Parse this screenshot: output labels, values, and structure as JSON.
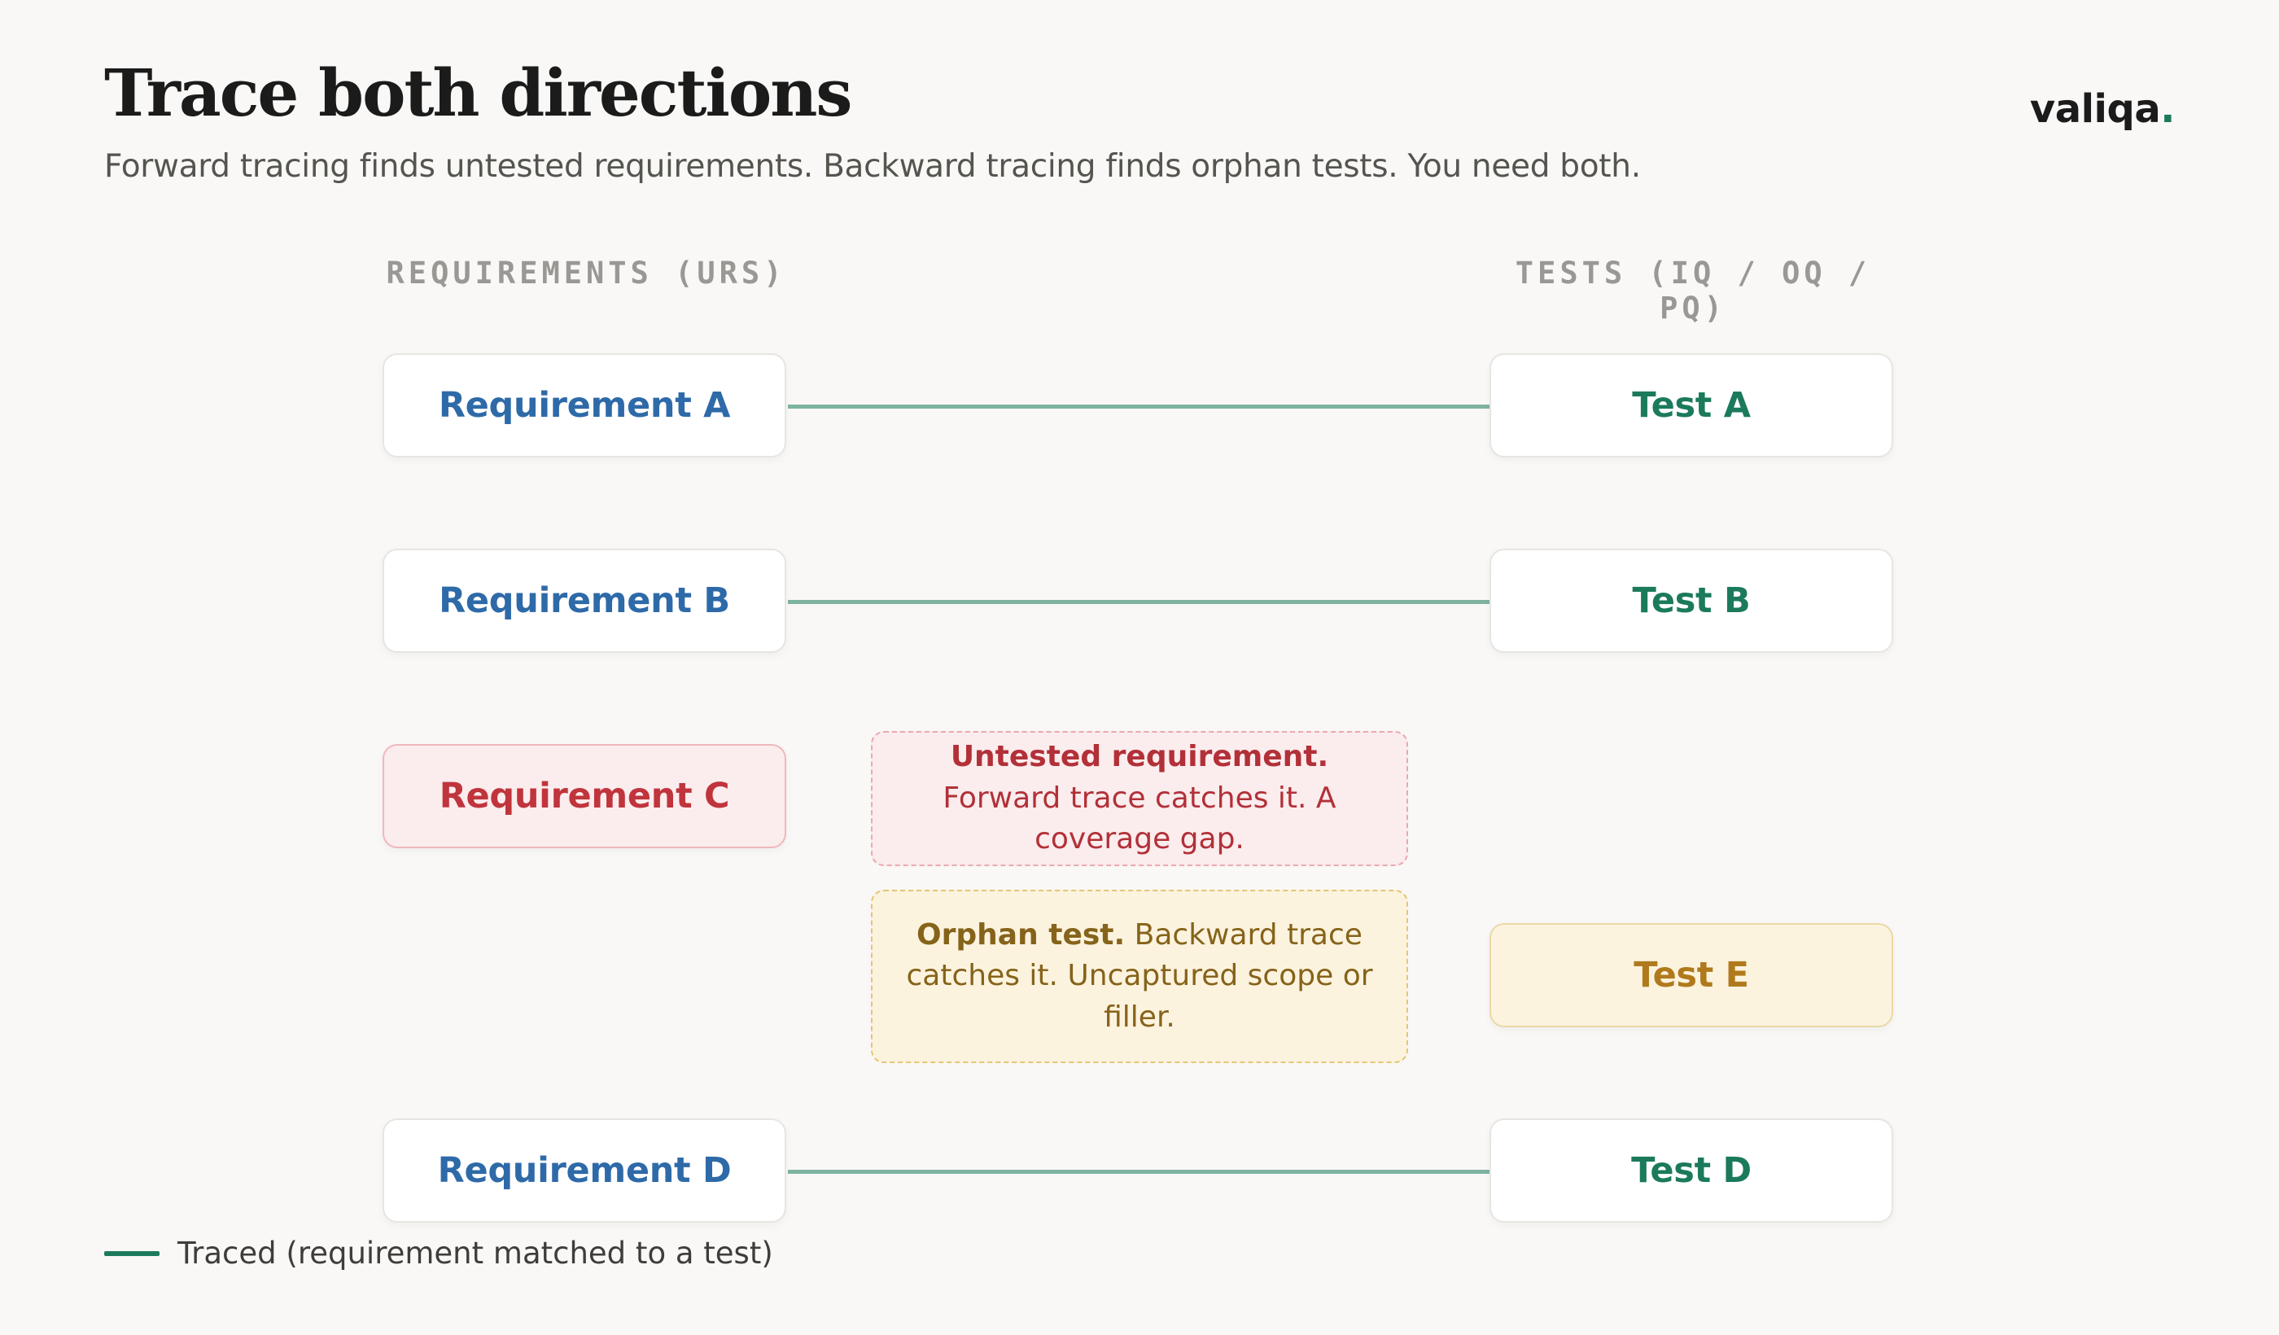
{
  "header": {
    "title": "Trace both directions",
    "subtitle": "Forward tracing finds untested requirements. Backward tracing finds orphan tests. You need both.",
    "brand": "valiqa",
    "brand_dot": "."
  },
  "columns": {
    "requirements": "REQUIREMENTS (URS)",
    "tests": "TESTS (IQ / OQ / PQ)"
  },
  "requirements": [
    {
      "label": "Requirement A",
      "status": "traced"
    },
    {
      "label": "Requirement B",
      "status": "traced"
    },
    {
      "label": "Requirement C",
      "status": "untested"
    },
    {
      "label": "Requirement D",
      "status": "traced"
    }
  ],
  "tests": [
    {
      "label": "Test A",
      "status": "traced"
    },
    {
      "label": "Test B",
      "status": "traced"
    },
    {
      "label": "Test E",
      "status": "orphan"
    },
    {
      "label": "Test D",
      "status": "traced"
    }
  ],
  "notes": {
    "untested": {
      "bold": "Untested requirement.",
      "text": " Forward trace catches it. A coverage gap."
    },
    "orphan": {
      "bold": "Orphan test.",
      "text": " Backward trace catches it. Uncaptured scope or filler."
    }
  },
  "legend": {
    "label": "Traced (requirement matched to a test)"
  },
  "colors": {
    "background": "#f9f8f6",
    "requirement": "#2e6aa8",
    "test": "#1c7a5c",
    "trace_line": "#7db3a0",
    "gap_red": "#c0343c",
    "orphan_amber": "#b07a1c"
  }
}
